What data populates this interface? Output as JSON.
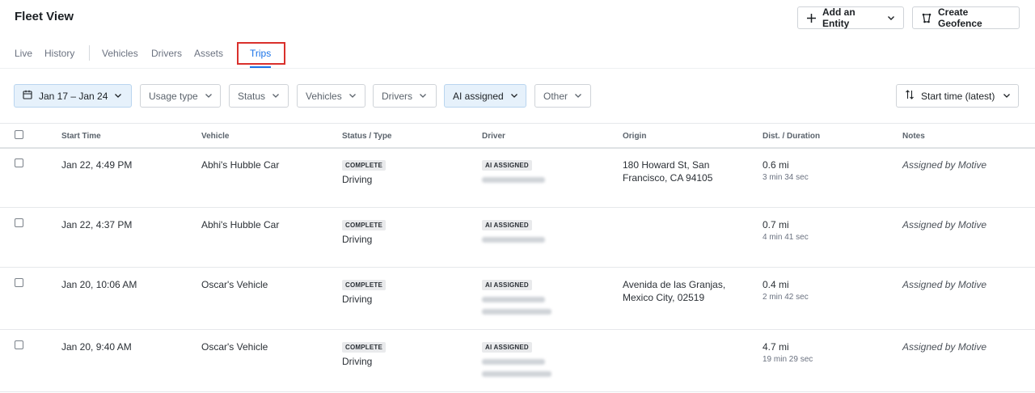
{
  "header": {
    "title": "Fleet View",
    "add_entity_label": "Add an Entity",
    "create_geofence_label": "Create Geofence"
  },
  "tabs": [
    {
      "label": "Live"
    },
    {
      "label": "History"
    },
    {
      "label": "Vehicles"
    },
    {
      "label": "Drivers"
    },
    {
      "label": "Assets"
    },
    {
      "label": "Trips",
      "active": true
    }
  ],
  "filters": {
    "date_range": "Jan 17 – Jan 24",
    "usage_type": "Usage type",
    "status": "Status",
    "vehicles": "Vehicles",
    "drivers": "Drivers",
    "ai_assigned": "AI assigned",
    "other": "Other",
    "sort": "Start time (latest)"
  },
  "table": {
    "columns": [
      "Start Time",
      "Vehicle",
      "Status / Type",
      "Driver",
      "Origin",
      "Dist. / Duration",
      "Notes"
    ],
    "rows": [
      {
        "start_time": "Jan 22, 4:49 PM",
        "vehicle": "Abhi's Hubble Car",
        "status": "COMPLETE",
        "type": "Driving",
        "driver_badge": "AI ASSIGNED",
        "origin_line1": "180 Howard St, San",
        "origin_line2": "Francisco, CA 94105",
        "distance": "0.6 mi",
        "duration": "3 min 34 sec",
        "notes": "Assigned by Motive"
      },
      {
        "start_time": "Jan 22, 4:37 PM",
        "vehicle": "Abhi's Hubble Car",
        "status": "COMPLETE",
        "type": "Driving",
        "driver_badge": "AI ASSIGNED",
        "origin_line1": "",
        "origin_line2": "",
        "distance": "0.7 mi",
        "duration": "4 min 41 sec",
        "notes": "Assigned by Motive"
      },
      {
        "start_time": "Jan 20, 10:06 AM",
        "vehicle": "Oscar's Vehicle",
        "status": "COMPLETE",
        "type": "Driving",
        "driver_badge": "AI ASSIGNED",
        "origin_line1": "Avenida de las Granjas,",
        "origin_line2": "Mexico City, 02519",
        "distance": "0.4 mi",
        "duration": "2 min 42 sec",
        "notes": "Assigned by Motive"
      },
      {
        "start_time": "Jan 20, 9:40 AM",
        "vehicle": "Oscar's Vehicle",
        "status": "COMPLETE",
        "type": "Driving",
        "driver_badge": "AI ASSIGNED",
        "origin_line1": "",
        "origin_line2": "",
        "distance": "4.7 mi",
        "duration": "19 min 29 sec",
        "notes": "Assigned by Motive"
      }
    ]
  },
  "colors": {
    "accent": "#1a73e8",
    "highlight": "#d9302c",
    "selected_filter_bg": "#e6f1fb"
  }
}
